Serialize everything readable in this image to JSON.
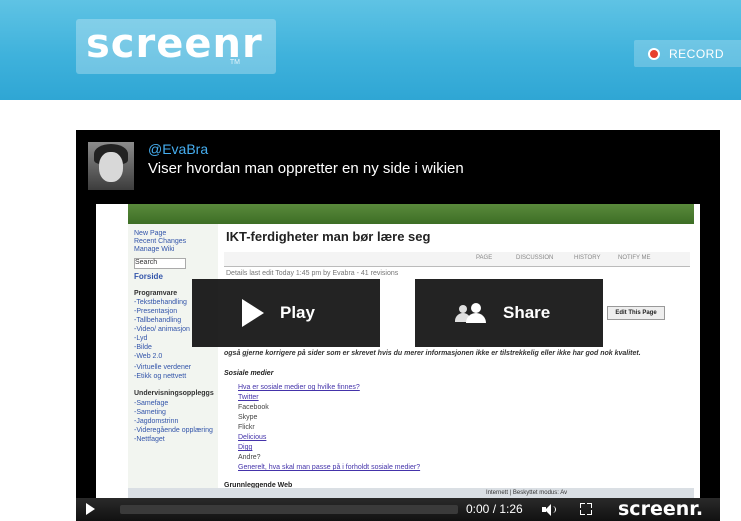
{
  "header": {
    "logo": "screenr",
    "logo_tm": "TM",
    "record_label": "RECORD"
  },
  "player": {
    "username": "@EvaBra",
    "caption": "Viser hvordan man oppretter en ny side i wikien",
    "play_label": "Play",
    "share_label": "Share",
    "time": "0:00 / 1:26",
    "logo": "screenr."
  },
  "wiki": {
    "sidebar": [
      "New Page",
      "Recent Changes",
      "Manage Wiki",
      "Search",
      "Forside",
      "Programvare",
      "-Tekstbehandling",
      "-Presentasjon",
      "-Tallbehandling",
      "-Video/ animasjon",
      "-Lyd",
      "-Bilde",
      "-Web 2.0",
      "-Virtuelle verdener",
      "-Etikk og nettvett",
      "Undervisningsoppleggs",
      "-Samefage",
      "-Sameting",
      "-Jagdomstrinn",
      "-Videregående opplæring",
      "-Nettfaget"
    ],
    "title": "IKT-ferdigheter man bør lære seg",
    "tabs": [
      "PAGE",
      "DISCUSSION",
      "HISTORY",
      "NOTIFY ME"
    ],
    "details": "Details  last edit Today 1:45 pm by  Evabra - 41 revisions",
    "edit_button": "Edit This Page",
    "body_line": "også gjerne korrigere på sider som er skrevet hvis du merer informasjonen ikke er tilstrekkelig eller ikke har god nok kvalitet.",
    "section": "Sosiale medier",
    "list": [
      "Hva er sosiale medier og hvilke finnes?",
      "Twitter",
      "Facebook",
      "Skype",
      "Flickr",
      "Delicious",
      "Digg",
      "Andre?",
      "Generelt, hva skal man passe på i forholdt sosiale medier?"
    ],
    "section2": "Grunnleggende Web",
    "status": "Internett | Beskyttet modus: Av"
  }
}
